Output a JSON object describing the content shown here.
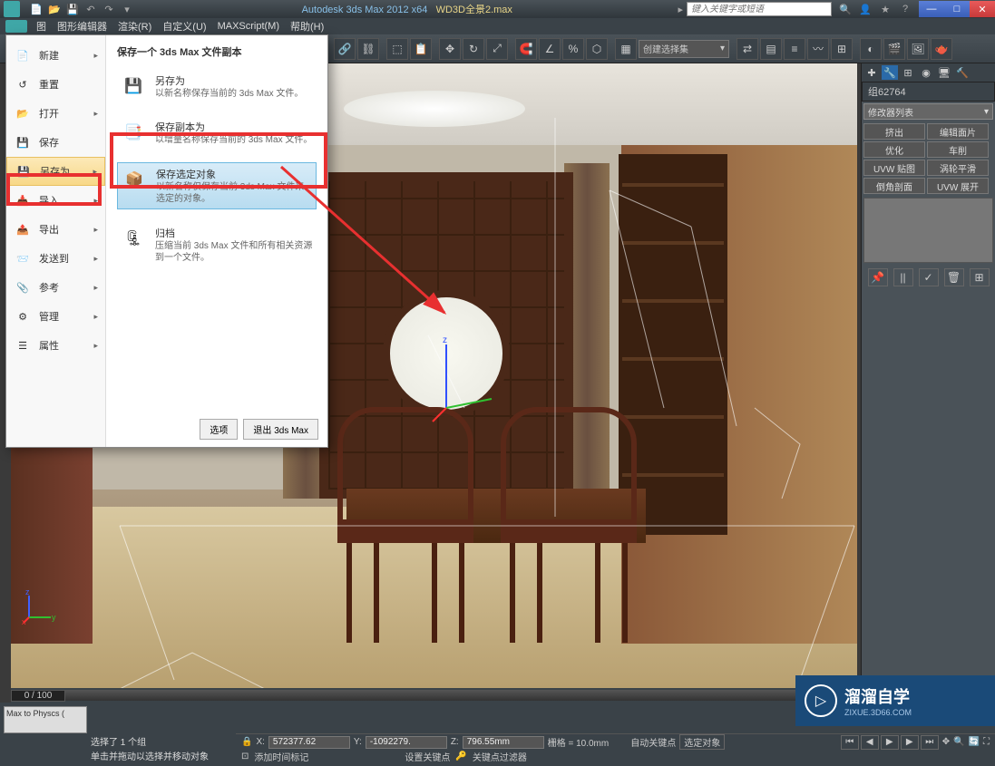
{
  "title": {
    "app": "Autodesk 3ds Max  2012 x64",
    "file": "WD3D全景2.max",
    "search_placeholder": "键入关键字或短语"
  },
  "menu": {
    "items": [
      "图",
      "图形编辑器",
      "渲染(R)",
      "自定义(U)",
      "MAXScript(M)",
      "帮助(H)"
    ]
  },
  "toolbar": {
    "snap_dropdown": "创建选择集"
  },
  "app_menu": {
    "left_items": [
      {
        "label": "新建",
        "icon": "new"
      },
      {
        "label": "重置",
        "icon": "reset"
      },
      {
        "label": "打开",
        "icon": "open"
      },
      {
        "label": "保存",
        "icon": "save"
      },
      {
        "label": "另存为",
        "icon": "saveas",
        "highlighted": true
      },
      {
        "label": "导入",
        "icon": "import"
      },
      {
        "label": "导出",
        "icon": "export"
      },
      {
        "label": "发送到",
        "icon": "sendto"
      },
      {
        "label": "参考",
        "icon": "reference"
      },
      {
        "label": "管理",
        "icon": "manage"
      },
      {
        "label": "属性",
        "icon": "properties"
      }
    ],
    "right_title": "保存一个 3ds Max 文件副本",
    "right_items": [
      {
        "title": "另存为",
        "desc": "以新名称保存当前的 3ds Max 文件。",
        "icon": "saveas"
      },
      {
        "title": "保存副本为",
        "desc": "以增量名称保存当前的 3ds Max 文件。",
        "icon": "savecopy"
      },
      {
        "title": "保存选定对象",
        "desc": "以新名称仅保存当前 3ds Max 文件来选定的对象。",
        "icon": "saveselected",
        "highlighted": true
      },
      {
        "title": "归档",
        "desc": "压缩当前 3ds Max 文件和所有相关资源到一个文件。",
        "icon": "archive"
      }
    ],
    "footer": {
      "options": "选项",
      "exit": "退出 3ds Max"
    }
  },
  "right_panel": {
    "group_label": "组62764",
    "modifier_list": "修改器列表",
    "buttons": [
      "挤出",
      "编辑面片",
      "优化",
      "车削",
      "UVW 贴图",
      "涡轮平滑",
      "倒角剖面",
      "UVW 展开"
    ]
  },
  "timeline": {
    "frame": "0 / 100"
  },
  "status": {
    "selection": "选择了 1 个组",
    "hint": "单击并拖动以选择并移动对象",
    "x_label": "X:",
    "x_val": "572377.62",
    "y_label": "Y:",
    "y_val": "-1092279.",
    "z_label": "Z:",
    "z_val": "796.55mm",
    "grid_label": "栅格 = 10.0mm",
    "autokey": "自动关键点",
    "selected": "选定对象",
    "setkey": "设置关键点",
    "keyfilter": "关键点过滤器",
    "addtime": "添加时间标记"
  },
  "script_box": "Max to Physcs (",
  "watermark": {
    "title": "溜溜自学",
    "url": "ZIXUE.3D66.COM"
  }
}
